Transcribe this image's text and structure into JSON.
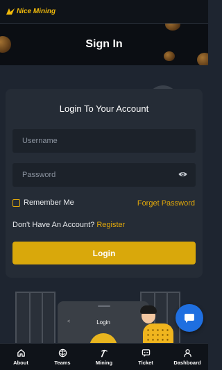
{
  "app": {
    "logo_text": "Nice Mining",
    "brand_color": "#f0b90b"
  },
  "hero": {
    "title": "Sign In"
  },
  "login_card": {
    "title": "Login To Your Account",
    "username_placeholder": "Username",
    "username_value": "",
    "password_placeholder": "Password",
    "password_value": "",
    "remember_label": "Remember Me",
    "remember_checked": false,
    "forget_link": "Forget Password",
    "no_account_text": "Don't Have An Account?",
    "register_link": "Register",
    "login_button": "Login"
  },
  "illustration": {
    "phone_title": "Login",
    "phone_back": "<"
  },
  "chat_button": {
    "icon": "chat-icon"
  },
  "bottom_nav": {
    "items": [
      {
        "label": "About",
        "icon": "home-icon"
      },
      {
        "label": "Teams",
        "icon": "teams-icon"
      },
      {
        "label": "Mining",
        "icon": "pickaxe-icon"
      },
      {
        "label": "Ticket",
        "icon": "ticket-icon"
      },
      {
        "label": "Dashboard",
        "icon": "user-icon"
      }
    ]
  }
}
